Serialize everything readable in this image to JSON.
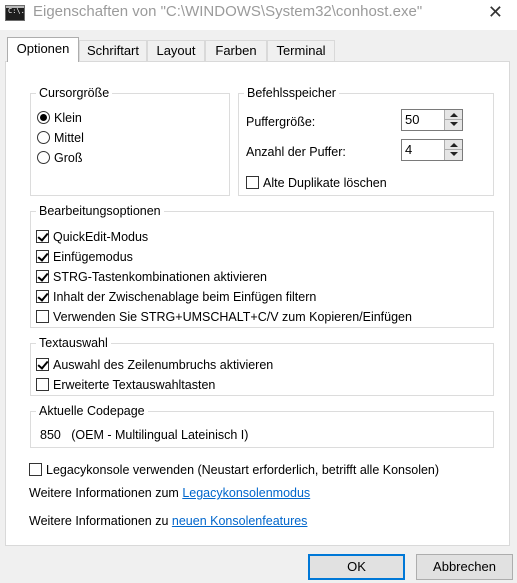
{
  "window": {
    "title": "Eigenschaften von \"C:\\WINDOWS\\System32\\conhost.exe\"",
    "icon_text": "C:\\.",
    "close_glyph": "✕"
  },
  "tabs": [
    {
      "label": "Optionen",
      "active": true
    },
    {
      "label": "Schriftart",
      "active": false
    },
    {
      "label": "Layout",
      "active": false
    },
    {
      "label": "Farben",
      "active": false
    },
    {
      "label": "Terminal",
      "active": false
    }
  ],
  "cursor": {
    "title": "Cursorgröße",
    "options": [
      {
        "label": "Klein",
        "selected": true
      },
      {
        "label": "Mittel",
        "selected": false
      },
      {
        "label": "Groß",
        "selected": false
      }
    ]
  },
  "buffer": {
    "title": "Befehlsspeicher",
    "size_label": "Puffergröße:",
    "size_value": "50",
    "count_label": "Anzahl der Puffer:",
    "count_value": "4",
    "discard_label": "Alte Duplikate löschen",
    "discard_checked": false
  },
  "edit": {
    "title": "Bearbeitungsoptionen",
    "options": [
      {
        "label": "QuickEdit-Modus",
        "checked": true
      },
      {
        "label": "Einfügemodus",
        "checked": true
      },
      {
        "label": "STRG-Tastenkombinationen aktivieren",
        "checked": true
      },
      {
        "label": "Inhalt der Zwischenablage beim Einfügen filtern",
        "checked": true
      },
      {
        "label": "Verwenden Sie STRG+UMSCHALT+C/V zum Kopieren/Einfügen",
        "checked": false
      }
    ]
  },
  "selection": {
    "title": "Textauswahl",
    "options": [
      {
        "label": "Auswahl des Zeilenumbruchs aktivieren",
        "checked": true
      },
      {
        "label": "Erweiterte Textauswahltasten",
        "checked": false
      }
    ]
  },
  "codepage": {
    "title": "Aktuelle Codepage",
    "value": "850   (OEM - Multilingual Lateinisch I)"
  },
  "legacy": {
    "label": "Legacykonsole verwenden (Neustart erforderlich, betrifft alle Konsolen)",
    "checked": false,
    "info_prefix": "Weitere Informationen zum ",
    "info_link": "Legacykonsolenmodus",
    "features_prefix": "Weitere Informationen zu ",
    "features_link": "neuen Konsolenfeatures"
  },
  "buttons": {
    "ok": "OK",
    "cancel": "Abbrechen"
  }
}
